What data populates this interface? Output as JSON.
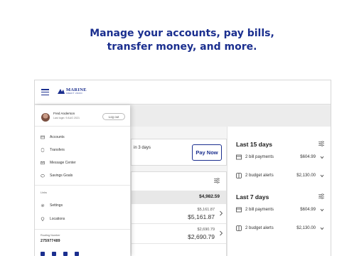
{
  "headline": {
    "line1": "Manage your accounts, pay bills,",
    "line2": "transfer money, and more."
  },
  "brand": {
    "logo_name": "MARINE",
    "logo_sub": "CREDIT UNION",
    "color": "#1b2f8f"
  },
  "drawer": {
    "user_name": "Fred Anderson",
    "last_login": "Last login: 9 AUG 2021",
    "logout_label": "Log out",
    "nav_items": [
      {
        "label": "Accounts",
        "icon": "accounts-icon"
      },
      {
        "label": "Transfers",
        "icon": "transfers-icon"
      },
      {
        "label": "Message Center",
        "icon": "mail-icon"
      },
      {
        "label": "Savings Goals",
        "icon": "savings-icon"
      }
    ],
    "links_label": "Links",
    "link_items": [
      {
        "label": "Settings",
        "icon": "gear-icon"
      },
      {
        "label": "Locations",
        "icon": "location-pin-icon"
      }
    ],
    "routing_label": "Routing Number",
    "routing_number": "275977489",
    "social_icons": [
      "linkedin-icon",
      "facebook-icon",
      "twitter-icon",
      "instagram-icon"
    ]
  },
  "main": {
    "alert_text": "in 3 days",
    "pay_now_label": "Pay Now",
    "total": "$4,982.59",
    "accounts": [
      {
        "available": "$5,161.87",
        "balance": "$5,161.87"
      },
      {
        "available": "$2,690.79",
        "balance": "$2,690.79"
      }
    ]
  },
  "right_panel": {
    "sections": [
      {
        "title": "Last 15 days",
        "rows": [
          {
            "label": "2 bill payments",
            "amount": "$604.99",
            "icon": "bill-icon"
          },
          {
            "label": "2 budget alerts",
            "amount": "$2,130.00",
            "icon": "budget-icon"
          }
        ]
      },
      {
        "title": "Last 7 days",
        "rows": [
          {
            "label": "2 bill payments",
            "amount": "$604.99",
            "icon": "bill-icon"
          },
          {
            "label": "2 budget alerts",
            "amount": "$2,130.00",
            "icon": "budget-icon"
          }
        ]
      }
    ]
  }
}
